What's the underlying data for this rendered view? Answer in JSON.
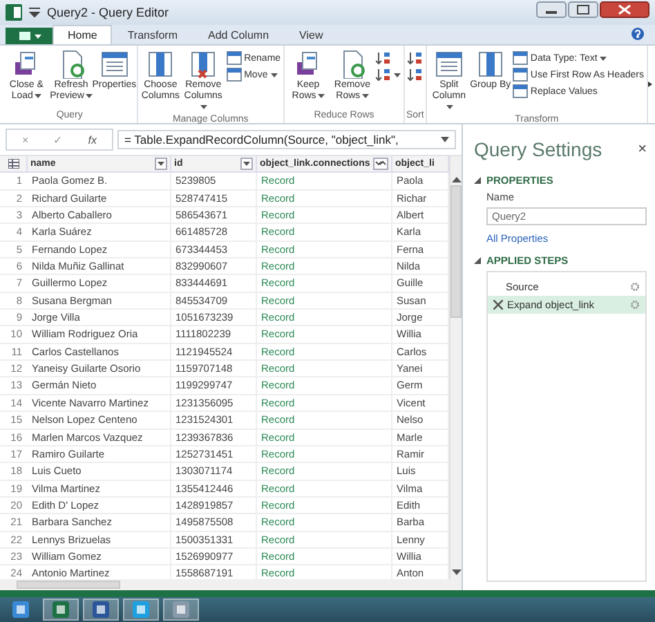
{
  "window": {
    "title": "Query2 - Query Editor"
  },
  "tabs": [
    {
      "label": "Home",
      "selected": true
    },
    {
      "label": "Transform",
      "selected": false
    },
    {
      "label": "Add Column",
      "selected": false
    },
    {
      "label": "View",
      "selected": false
    }
  ],
  "ribbon": [
    {
      "label": "Query",
      "buttons": [
        {
          "kind": "large",
          "label": "Close & Load",
          "dropdown": true
        },
        {
          "kind": "large",
          "label": "Refresh Preview",
          "dropdown": true
        },
        {
          "kind": "large",
          "label": "Properties",
          "dropdown": false
        }
      ]
    },
    {
      "label": "Manage Columns",
      "buttons": [
        {
          "kind": "large",
          "label": "Choose Columns",
          "dropdown": false
        },
        {
          "kind": "large",
          "label": "Remove Columns",
          "dropdown": true
        },
        {
          "kind": "small",
          "label": "Rename",
          "dropdown": false
        },
        {
          "kind": "small",
          "label": "Move",
          "dropdown": true
        }
      ]
    },
    {
      "label": "Reduce Rows",
      "buttons": [
        {
          "kind": "large",
          "label": "Keep Rows",
          "dropdown": true
        },
        {
          "kind": "large",
          "label": "Remove Rows",
          "dropdown": true
        },
        {
          "kind": "icon",
          "dropdown": false
        },
        {
          "kind": "icon",
          "dropdown": true
        }
      ]
    },
    {
      "label": "Sort",
      "buttons": [
        {
          "kind": "icon",
          "dropdown": false
        },
        {
          "kind": "icon",
          "dropdown": false
        }
      ]
    },
    {
      "label": "Transform",
      "buttons": [
        {
          "kind": "large",
          "label": "Split Column",
          "dropdown": true
        },
        {
          "kind": "large",
          "label": "Group By",
          "dropdown": false
        },
        {
          "kind": "small",
          "label": "Data Type: Text",
          "dropdown": true
        },
        {
          "kind": "small",
          "label": "Use First Row As Headers",
          "dropdown": false
        },
        {
          "kind": "small",
          "label": "Replace Values",
          "dropdown": false
        }
      ]
    }
  ],
  "formula_bar": {
    "buttons": [
      "×",
      "✓",
      "fx"
    ],
    "formula": "= Table.ExpandRecordColumn(Source, \"object_link\","
  },
  "table": {
    "columns": [
      {
        "label": "name",
        "kind": "filter"
      },
      {
        "label": "id",
        "kind": "filter"
      },
      {
        "label": "object_link.connections",
        "kind": "expand"
      },
      {
        "label": "object_li",
        "kind": "none"
      }
    ],
    "rows": [
      {
        "number": "1",
        "cells": [
          "Paola Gomez B.",
          "5239805",
          "Record",
          "Paola"
        ]
      },
      {
        "number": "2",
        "cells": [
          "Richard Guilarte",
          "528747415",
          "Record",
          "Richar"
        ]
      },
      {
        "number": "3",
        "cells": [
          "Alberto Caballero",
          "586543671",
          "Record",
          "Albert"
        ]
      },
      {
        "number": "4",
        "cells": [
          "Karla Suárez",
          "661485728",
          "Record",
          "Karla"
        ]
      },
      {
        "number": "5",
        "cells": [
          "Fernando Lopez",
          "673344453",
          "Record",
          "Ferna"
        ]
      },
      {
        "number": "6",
        "cells": [
          "Nilda Muñiz Gallinat",
          "832990607",
          "Record",
          "Nilda"
        ]
      },
      {
        "number": "7",
        "cells": [
          "Guillermo Lopez",
          "833444691",
          "Record",
          "Guille"
        ]
      },
      {
        "number": "8",
        "cells": [
          "Susana Bergman",
          "845534709",
          "Record",
          "Susan"
        ]
      },
      {
        "number": "9",
        "cells": [
          "Jorge Villa",
          "1051673239",
          "Record",
          "Jorge"
        ]
      },
      {
        "number": "10",
        "cells": [
          "William Rodriguez Oria",
          "1111802239",
          "Record",
          "Willia"
        ]
      },
      {
        "number": "11",
        "cells": [
          "Carlos Castellanos",
          "1121945524",
          "Record",
          "Carlos"
        ]
      },
      {
        "number": "12",
        "cells": [
          "Yaneisy Guilarte Osorio",
          "1159707148",
          "Record",
          "Yanei"
        ]
      },
      {
        "number": "13",
        "cells": [
          "Germán Nieto",
          "1199299747",
          "Record",
          "Germ"
        ]
      },
      {
        "number": "14",
        "cells": [
          "Vicente Navarro Martinez",
          "1231356095",
          "Record",
          "Vicent"
        ]
      },
      {
        "number": "15",
        "cells": [
          "Nelson Lopez Centeno",
          "1231524301",
          "Record",
          "Nelso"
        ]
      },
      {
        "number": "16",
        "cells": [
          "Marlen Marcos Vazquez",
          "1239367836",
          "Record",
          "Marle"
        ]
      },
      {
        "number": "17",
        "cells": [
          "Ramiro Guilarte",
          "1252731451",
          "Record",
          "Ramir"
        ]
      },
      {
        "number": "18",
        "cells": [
          "Luis Cueto",
          "1303071174",
          "Record",
          "Luis"
        ]
      },
      {
        "number": "19",
        "cells": [
          "Vilma Martinez",
          "1355412446",
          "Record",
          "Vilma"
        ]
      },
      {
        "number": "20",
        "cells": [
          "Edith D' Lopez",
          "1428919857",
          "Record",
          "Edith"
        ]
      },
      {
        "number": "21",
        "cells": [
          "Barbara Sanchez",
          "1495875508",
          "Record",
          "Barba"
        ]
      },
      {
        "number": "22",
        "cells": [
          "Lennys Brizuelas",
          "1500351331",
          "Record",
          "Lenny"
        ]
      },
      {
        "number": "23",
        "cells": [
          "William Gomez",
          "1526990977",
          "Record",
          "Willia"
        ]
      },
      {
        "number": "24",
        "cells": [
          "Antonio Martinez",
          "1558687191",
          "Record",
          "Anton"
        ]
      }
    ]
  },
  "query_settings": {
    "title": "Query Settings",
    "close": "×",
    "properties": {
      "heading": "PROPERTIES",
      "expanded": true,
      "name_label": "Name",
      "name_value": "Query2",
      "link": "All Properties"
    },
    "applied_steps": {
      "heading": "APPLIED STEPS",
      "expanded": true,
      "steps": [
        {
          "label": "Source",
          "selected": false
        },
        {
          "label": "Expand object_link",
          "selected": true
        }
      ]
    }
  }
}
